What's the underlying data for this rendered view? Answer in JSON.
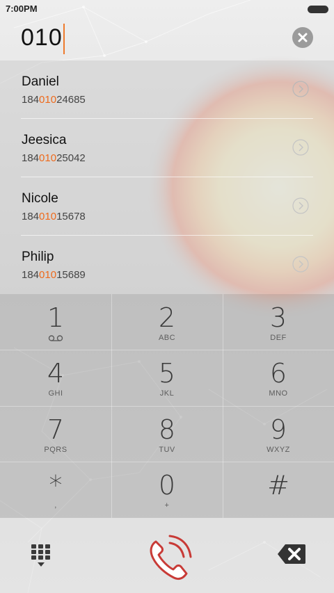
{
  "status_bar": {
    "time": "7:00PM"
  },
  "dialer": {
    "input_value": "010"
  },
  "contacts": [
    {
      "name": "Daniel",
      "number_prefix": "184",
      "number_match": "010",
      "number_suffix": "24685"
    },
    {
      "name": "Jeesica",
      "number_prefix": "184",
      "number_match": "010",
      "number_suffix": "25042"
    },
    {
      "name": "Nicole",
      "number_prefix": "184",
      "number_match": "010",
      "number_suffix": "15678"
    },
    {
      "name": "Philip",
      "number_prefix": "184",
      "number_match": "010",
      "number_suffix": "15689"
    }
  ],
  "keypad": [
    {
      "digit": "1",
      "sub": ""
    },
    {
      "digit": "2",
      "sub": "ABC"
    },
    {
      "digit": "3",
      "sub": "DEF"
    },
    {
      "digit": "4",
      "sub": "GHI"
    },
    {
      "digit": "5",
      "sub": "JKL"
    },
    {
      "digit": "6",
      "sub": "MNO"
    },
    {
      "digit": "7",
      "sub": "PQRS"
    },
    {
      "digit": "8",
      "sub": "TUV"
    },
    {
      "digit": "9",
      "sub": "WXYZ"
    },
    {
      "digit": "*",
      "sub": ","
    },
    {
      "digit": "0",
      "sub": "+"
    },
    {
      "digit": "#",
      "sub": ""
    }
  ],
  "icons": {
    "clear": "clear-input-icon",
    "voicemail": "voicemail-icon",
    "dialpad": "dialpad-icon",
    "call": "call-icon",
    "backspace": "backspace-icon",
    "contact_detail": "chevron-right-icon"
  },
  "colors": {
    "accent": "#ee6a1c",
    "background": "#d9d9d9"
  }
}
